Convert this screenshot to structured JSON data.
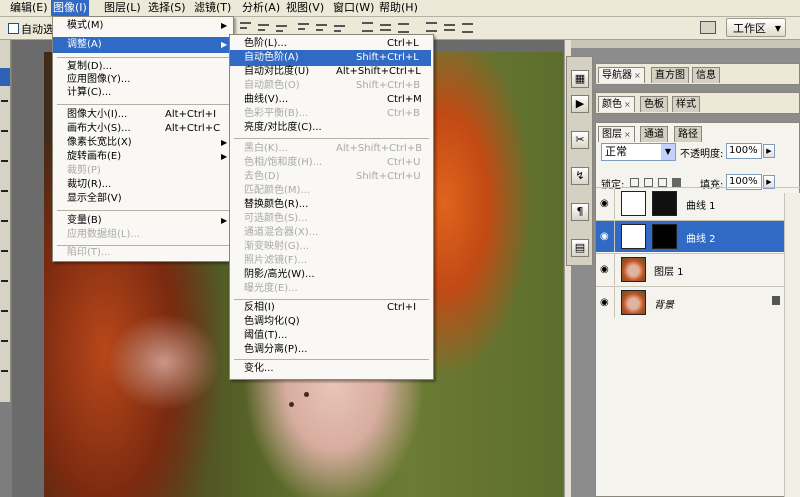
{
  "menubar": {
    "items": [
      "编辑(E)",
      "图像(I)",
      "图层(L)",
      "选择(S)",
      "滤镜(T)",
      "分析(A)",
      "视图(V)",
      "窗口(W)",
      "帮助(H)"
    ]
  },
  "options_bar": {
    "auto_select": "自动选",
    "workspace": "工作区"
  },
  "image_menu": {
    "items": [
      {
        "label": "模式(M)",
        "shortcut": "",
        "submenu": true,
        "disabled": false
      },
      {
        "label": "调整(A)",
        "shortcut": "",
        "submenu": true,
        "disabled": false
      },
      {
        "label": "复制(D)...",
        "shortcut": "",
        "submenu": false,
        "disabled": false
      },
      {
        "label": "应用图像(Y)...",
        "shortcut": "",
        "submenu": false,
        "disabled": false
      },
      {
        "label": "计算(C)...",
        "shortcut": "",
        "submenu": false,
        "disabled": false
      },
      {
        "label": "图像大小(I)...",
        "shortcut": "Alt+Ctrl+I",
        "submenu": false,
        "disabled": false
      },
      {
        "label": "画布大小(S)...",
        "shortcut": "Alt+Ctrl+C",
        "submenu": false,
        "disabled": false
      },
      {
        "label": "像素长宽比(X)",
        "shortcut": "",
        "submenu": true,
        "disabled": false
      },
      {
        "label": "旋转画布(E)",
        "shortcut": "",
        "submenu": true,
        "disabled": false
      },
      {
        "label": "裁剪(P)",
        "shortcut": "",
        "submenu": false,
        "disabled": true
      },
      {
        "label": "裁切(R)...",
        "shortcut": "",
        "submenu": false,
        "disabled": false
      },
      {
        "label": "显示全部(V)",
        "shortcut": "",
        "submenu": false,
        "disabled": false
      },
      {
        "label": "变量(B)",
        "shortcut": "",
        "submenu": true,
        "disabled": false
      },
      {
        "label": "应用数据组(L)...",
        "shortcut": "",
        "submenu": false,
        "disabled": true
      },
      {
        "label": "陷印(T)...",
        "shortcut": "",
        "submenu": false,
        "disabled": true
      }
    ]
  },
  "adjust_menu": {
    "items": [
      {
        "label": "色阶(L)...",
        "shortcut": "Ctrl+L",
        "disabled": false
      },
      {
        "label": "自动色阶(A)",
        "shortcut": "Shift+Ctrl+L",
        "disabled": false
      },
      {
        "label": "自动对比度(U)",
        "shortcut": "Alt+Shift+Ctrl+L",
        "disabled": false
      },
      {
        "label": "自动颜色(O)",
        "shortcut": "Shift+Ctrl+B",
        "disabled": true
      },
      {
        "label": "曲线(V)...",
        "shortcut": "Ctrl+M",
        "disabled": false
      },
      {
        "label": "色彩平衡(B)...",
        "shortcut": "Ctrl+B",
        "disabled": true
      },
      {
        "label": "亮度/对比度(C)...",
        "shortcut": "",
        "disabled": false
      },
      {
        "label": "黑白(K)...",
        "shortcut": "Alt+Shift+Ctrl+B",
        "disabled": true
      },
      {
        "label": "色相/饱和度(H)...",
        "shortcut": "Ctrl+U",
        "disabled": true
      },
      {
        "label": "去色(D)",
        "shortcut": "Shift+Ctrl+U",
        "disabled": true
      },
      {
        "label": "匹配颜色(M)...",
        "shortcut": "",
        "disabled": true
      },
      {
        "label": "替换颜色(R)...",
        "shortcut": "",
        "disabled": false
      },
      {
        "label": "可选颜色(S)...",
        "shortcut": "",
        "disabled": true
      },
      {
        "label": "通道混合器(X)...",
        "shortcut": "",
        "disabled": true
      },
      {
        "label": "渐变映射(G)...",
        "shortcut": "",
        "disabled": true
      },
      {
        "label": "照片滤镜(F)...",
        "shortcut": "",
        "disabled": true
      },
      {
        "label": "阴影/高光(W)...",
        "shortcut": "",
        "disabled": false
      },
      {
        "label": "曝光度(E)...",
        "shortcut": "",
        "disabled": true
      },
      {
        "label": "反相(I)",
        "shortcut": "Ctrl+I",
        "disabled": false
      },
      {
        "label": "色调均化(Q)",
        "shortcut": "",
        "disabled": false
      },
      {
        "label": "阈值(T)...",
        "shortcut": "",
        "disabled": false
      },
      {
        "label": "色调分离(P)...",
        "shortcut": "",
        "disabled": false
      },
      {
        "label": "变化...",
        "shortcut": "",
        "disabled": false
      }
    ]
  },
  "panels": {
    "navigator_tabs": [
      "导航器",
      "直方图",
      "信息"
    ],
    "color_tabs": [
      "颜色",
      "色板",
      "样式"
    ],
    "layers_tabs": [
      "图层",
      "通道",
      "路径"
    ]
  },
  "layers": {
    "blend_mode": "正常",
    "opacity_label": "不透明度:",
    "opacity": "100%",
    "lock_label": "锁定:",
    "fill_label": "填充:",
    "fill": "100%",
    "items": [
      {
        "name": "曲线 1",
        "selected": false,
        "kind": "adjustment"
      },
      {
        "name": "曲线 2",
        "selected": true,
        "kind": "adjustment"
      },
      {
        "name": "图层 1",
        "selected": false,
        "kind": "image"
      },
      {
        "name": "背景",
        "selected": false,
        "kind": "image"
      }
    ]
  },
  "colors": {
    "highlight": "#316ac5",
    "menubar_bg": "#ece9d8"
  }
}
